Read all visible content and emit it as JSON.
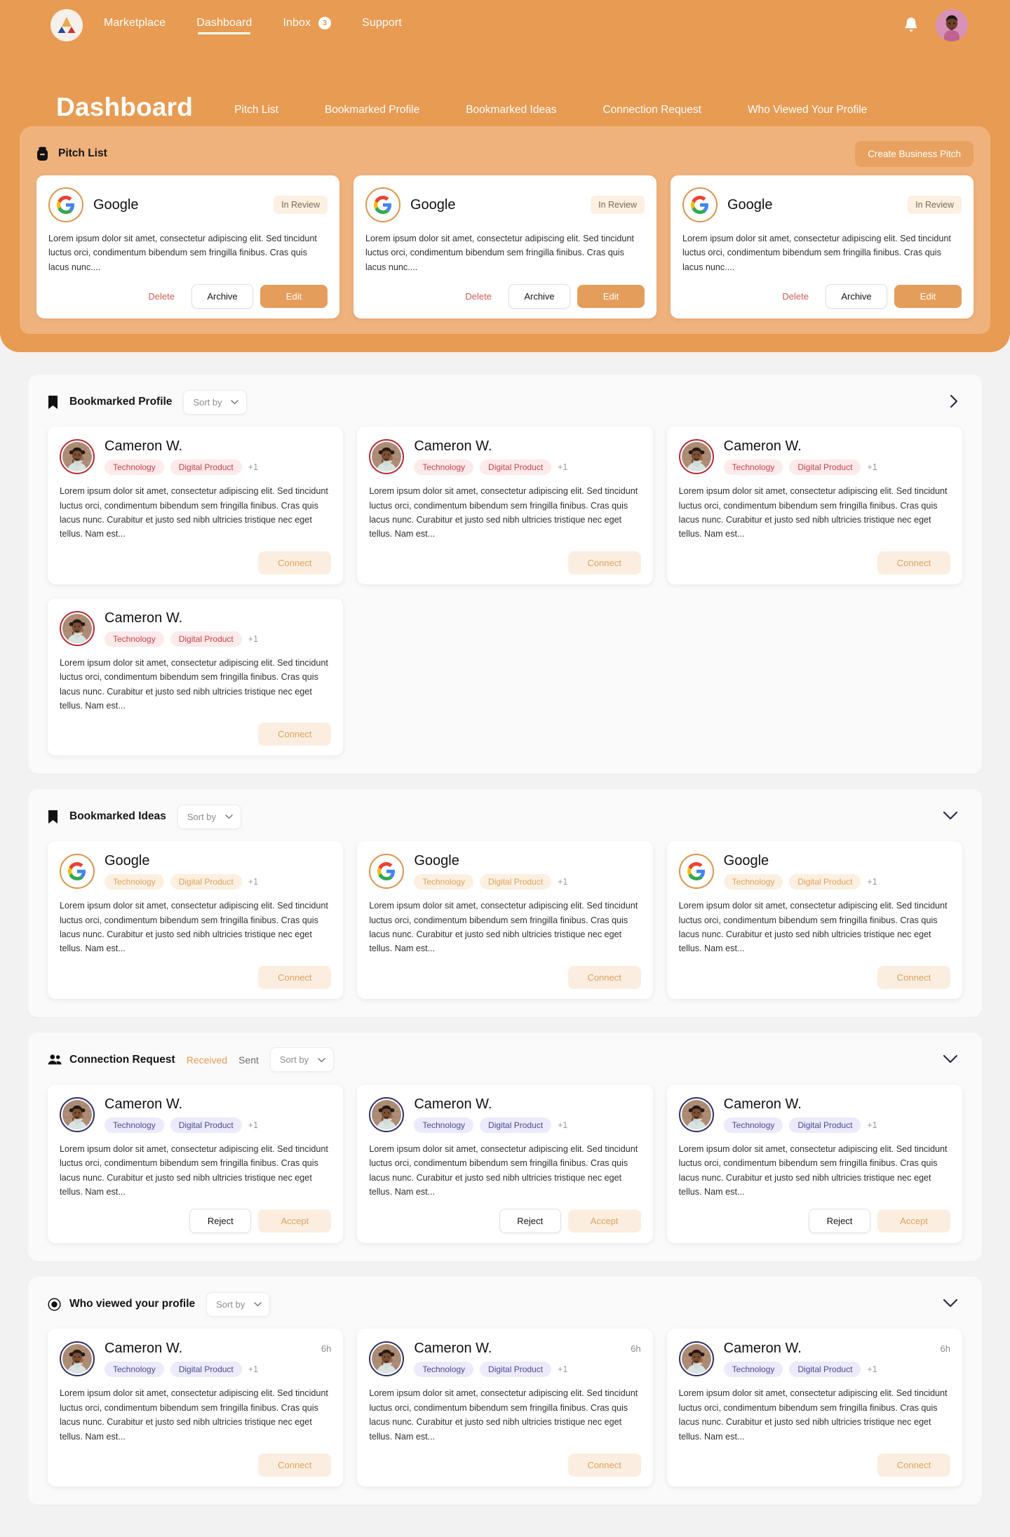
{
  "brand": {
    "logo_icon": "triangle-logo-icon",
    "accent": "#e89b52",
    "panel_accent": "#efb27c",
    "red": "#c6424b",
    "navy": "#4a4b8f"
  },
  "navbar": {
    "links": [
      {
        "label": "Marketplace",
        "active": false
      },
      {
        "label": "Dashboard",
        "active": true
      }
    ],
    "inbox": {
      "label": "Inbox",
      "badge": "3"
    },
    "support": {
      "label": "Support"
    },
    "bell_icon": "bell-icon",
    "avatar_icon": "user-avatar"
  },
  "page": {
    "title": "Dashboard",
    "tabs": [
      {
        "label": "Pitch List"
      },
      {
        "label": "Bookmarked Profile"
      },
      {
        "label": "Bookmarked Ideas"
      },
      {
        "label": "Connection Request"
      },
      {
        "label": "Who Viewed Your Profile"
      }
    ]
  },
  "pitch_list": {
    "icon": "archive-box-icon",
    "title": "Pitch List",
    "create_label": "Create Business Pitch",
    "buttons": {
      "delete": "Delete",
      "archive": "Archive",
      "edit": "Edit"
    },
    "cards": [
      {
        "name": "Google",
        "logo_icon": "google-logo-icon",
        "status": "In Review",
        "body": "Lorem ipsum dolor sit amet, consectetur adipiscing elit. Sed tincidunt luctus orci, condimentum bibendum sem fringilla finibus. Cras quis lacus nunc...."
      },
      {
        "name": "Google",
        "logo_icon": "google-logo-icon",
        "status": "In Review",
        "body": "Lorem ipsum dolor sit amet, consectetur adipiscing elit. Sed tincidunt luctus orci, condimentum bibendum sem fringilla finibus. Cras quis lacus nunc...."
      },
      {
        "name": "Google",
        "logo_icon": "google-logo-icon",
        "status": "In Review",
        "body": "Lorem ipsum dolor sit amet, consectetur adipiscing elit. Sed tincidunt luctus orci, condimentum bibendum sem fringilla finibus. Cras quis lacus nunc...."
      }
    ]
  },
  "bookmarked_profile": {
    "icon": "bookmark-icon",
    "title": "Bookmarked Profile",
    "sort_placeholder": "Sort by",
    "collapse_icon": "chevron-right-icon",
    "connect_label": "Connect",
    "cards": [
      {
        "name": "Cameron W.",
        "tags": [
          "Technology",
          "Digital Product"
        ],
        "extra": "+1",
        "body": "Lorem ipsum dolor sit amet, consectetur adipiscing elit. Sed tincidunt luctus orci, condimentum bibendum sem fringilla finibus. Cras quis lacus nunc. Curabitur et justo sed nibh ultricies tristique nec eget tellus. Nam est..."
      },
      {
        "name": "Cameron W.",
        "tags": [
          "Technology",
          "Digital Product"
        ],
        "extra": "+1",
        "body": "Lorem ipsum dolor sit amet, consectetur adipiscing elit. Sed tincidunt luctus orci, condimentum bibendum sem fringilla finibus. Cras quis lacus nunc. Curabitur et justo sed nibh ultricies tristique nec eget tellus. Nam est..."
      },
      {
        "name": "Cameron W.",
        "tags": [
          "Technology",
          "Digital Product"
        ],
        "extra": "+1",
        "body": "Lorem ipsum dolor sit amet, consectetur adipiscing elit. Sed tincidunt luctus orci, condimentum bibendum sem fringilla finibus. Cras quis lacus nunc. Curabitur et justo sed nibh ultricies tristique nec eget tellus. Nam est..."
      },
      {
        "name": "Cameron W.",
        "tags": [
          "Technology",
          "Digital Product"
        ],
        "extra": "+1",
        "body": "Lorem ipsum dolor sit amet, consectetur adipiscing elit. Sed tincidunt luctus orci, condimentum bibendum sem fringilla finibus. Cras quis lacus nunc. Curabitur et justo sed nibh ultricies tristique nec eget tellus. Nam est..."
      }
    ]
  },
  "bookmarked_ideas": {
    "icon": "bookmark-icon",
    "title": "Bookmarked Ideas",
    "sort_placeholder": "Sort by",
    "collapse_icon": "chevron-down-icon",
    "connect_label": "Connect",
    "cards": [
      {
        "name": "Google",
        "logo_icon": "google-logo-icon",
        "tags": [
          "Technology",
          "Digital Product"
        ],
        "extra": "+1",
        "body": "Lorem ipsum dolor sit amet, consectetur adipiscing elit. Sed tincidunt luctus orci, condimentum bibendum sem fringilla finibus. Cras quis lacus nunc. Curabitur et justo sed nibh ultricies tristique nec eget tellus. Nam est..."
      },
      {
        "name": "Google",
        "logo_icon": "google-logo-icon",
        "tags": [
          "Technology",
          "Digital Product"
        ],
        "extra": "+1",
        "body": "Lorem ipsum dolor sit amet, consectetur adipiscing elit. Sed tincidunt luctus orci, condimentum bibendum sem fringilla finibus. Cras quis lacus nunc. Curabitur et justo sed nibh ultricies tristique nec eget tellus. Nam est..."
      },
      {
        "name": "Google",
        "logo_icon": "google-logo-icon",
        "tags": [
          "Technology",
          "Digital Product"
        ],
        "extra": "+1",
        "body": "Lorem ipsum dolor sit amet, consectetur adipiscing elit. Sed tincidunt luctus orci, condimentum bibendum sem fringilla finibus. Cras quis lacus nunc. Curabitur et justo sed nibh ultricies tristique nec eget tellus. Nam est..."
      }
    ]
  },
  "connection_request": {
    "icon": "people-icon",
    "title": "Connection Request",
    "segments": [
      {
        "label": "Received",
        "active": true
      },
      {
        "label": "Sent",
        "active": false
      }
    ],
    "sort_placeholder": "Sort by",
    "collapse_icon": "chevron-down-icon",
    "buttons": {
      "reject": "Reject",
      "accept": "Accept"
    },
    "cards": [
      {
        "name": "Cameron W.",
        "tags": [
          "Technology",
          "Digital Product"
        ],
        "extra": "+1",
        "body": "Lorem ipsum dolor sit amet, consectetur adipiscing elit. Sed tincidunt luctus orci, condimentum bibendum sem fringilla finibus. Cras quis lacus nunc. Curabitur et justo sed nibh ultricies tristique nec eget tellus. Nam est..."
      },
      {
        "name": "Cameron W.",
        "tags": [
          "Technology",
          "Digital Product"
        ],
        "extra": "+1",
        "body": "Lorem ipsum dolor sit amet, consectetur adipiscing elit. Sed tincidunt luctus orci, condimentum bibendum sem fringilla finibus. Cras quis lacus nunc. Curabitur et justo sed nibh ultricies tristique nec eget tellus. Nam est..."
      },
      {
        "name": "Cameron W.",
        "tags": [
          "Technology",
          "Digital Product"
        ],
        "extra": "+1",
        "body": "Lorem ipsum dolor sit amet, consectetur adipiscing elit. Sed tincidunt luctus orci, condimentum bibendum sem fringilla finibus. Cras quis lacus nunc. Curabitur et justo sed nibh ultricies tristique nec eget tellus. Nam est..."
      }
    ]
  },
  "who_viewed": {
    "icon": "eye-icon",
    "title": "Who viewed your profile",
    "sort_placeholder": "Sort by",
    "collapse_icon": "chevron-down-icon",
    "connect_label": "Connect",
    "cards": [
      {
        "name": "Cameron W.",
        "time": "6h",
        "tags": [
          "Technology",
          "Digital Product"
        ],
        "extra": "+1",
        "body": "Lorem ipsum dolor sit amet, consectetur adipiscing elit. Sed tincidunt luctus orci, condimentum bibendum sem fringilla finibus. Cras quis lacus nunc. Curabitur et justo sed nibh ultricies tristique nec eget tellus. Nam est..."
      },
      {
        "name": "Cameron W.",
        "time": "6h",
        "tags": [
          "Technology",
          "Digital Product"
        ],
        "extra": "+1",
        "body": "Lorem ipsum dolor sit amet, consectetur adipiscing elit. Sed tincidunt luctus orci, condimentum bibendum sem fringilla finibus. Cras quis lacus nunc. Curabitur et justo sed nibh ultricies tristique nec eget tellus. Nam est..."
      },
      {
        "name": "Cameron W.",
        "time": "6h",
        "tags": [
          "Technology",
          "Digital Product"
        ],
        "extra": "+1",
        "body": "Lorem ipsum dolor sit amet, consectetur adipiscing elit. Sed tincidunt luctus orci, condimentum bibendum sem fringilla finibus. Cras quis lacus nunc. Curabitur et justo sed nibh ultricies tristique nec eget tellus. Nam est..."
      }
    ]
  }
}
